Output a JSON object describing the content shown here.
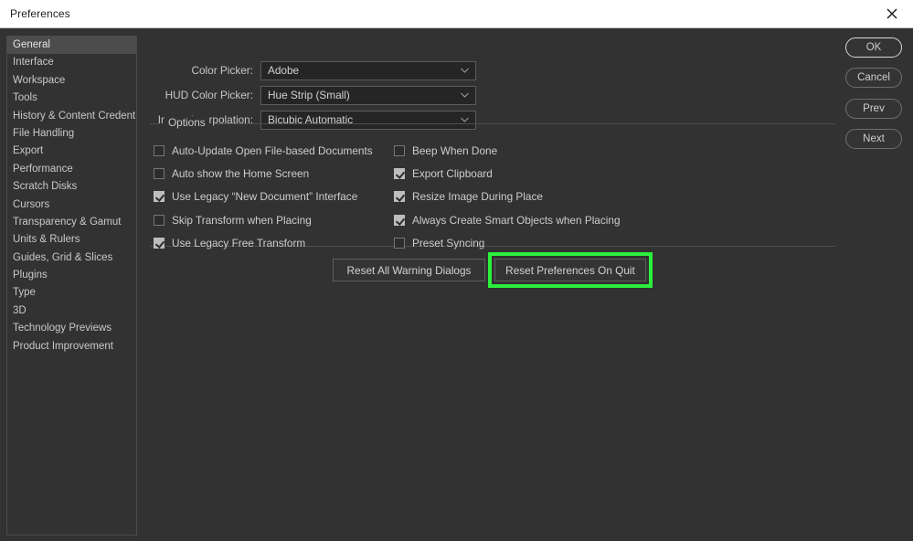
{
  "window": {
    "title": "Preferences",
    "close_icon": "close-icon"
  },
  "sidebar": {
    "items": [
      {
        "label": "General",
        "selected": true
      },
      {
        "label": "Interface",
        "selected": false
      },
      {
        "label": "Workspace",
        "selected": false
      },
      {
        "label": "Tools",
        "selected": false
      },
      {
        "label": "History & Content Credentials",
        "selected": false
      },
      {
        "label": "File Handling",
        "selected": false
      },
      {
        "label": "Export",
        "selected": false
      },
      {
        "label": "Performance",
        "selected": false
      },
      {
        "label": "Scratch Disks",
        "selected": false
      },
      {
        "label": "Cursors",
        "selected": false
      },
      {
        "label": "Transparency & Gamut",
        "selected": false
      },
      {
        "label": "Units & Rulers",
        "selected": false
      },
      {
        "label": "Guides, Grid & Slices",
        "selected": false
      },
      {
        "label": "Plugins",
        "selected": false
      },
      {
        "label": "Type",
        "selected": false
      },
      {
        "label": "3D",
        "selected": false
      },
      {
        "label": "Technology Previews",
        "selected": false
      },
      {
        "label": "Product Improvement",
        "selected": false
      }
    ]
  },
  "action_buttons": {
    "ok": "OK",
    "cancel": "Cancel",
    "prev": "Prev",
    "next": "Next"
  },
  "fields": [
    {
      "label": "Color Picker:",
      "value": "Adobe",
      "arrow_icon": "chevron-down-icon"
    },
    {
      "label": "HUD Color Picker:",
      "value": "Hue Strip (Small)",
      "arrow_icon": "chevron-down-icon"
    },
    {
      "label": "Image Interpolation:",
      "value": "Bicubic Automatic",
      "arrow_icon": "chevron-down-icon"
    }
  ],
  "options_group": {
    "legend": "Options",
    "left_column": [
      {
        "label": "Auto-Update Open File-based Documents",
        "checked": false
      },
      {
        "label": "Auto show the Home Screen",
        "checked": false
      },
      {
        "label": "Use Legacy “New Document” Interface",
        "checked": true
      },
      {
        "label": "Skip Transform when Placing",
        "checked": false
      },
      {
        "label": "Use Legacy Free Transform",
        "checked": true
      }
    ],
    "right_column": [
      {
        "label": "Beep When Done",
        "checked": false
      },
      {
        "label": "Export Clipboard",
        "checked": true
      },
      {
        "label": "Resize Image During Place",
        "checked": true
      },
      {
        "label": "Always Create Smart Objects when Placing",
        "checked": true
      },
      {
        "label": "Preset Syncing",
        "checked": false
      }
    ]
  },
  "bottom_buttons": {
    "reset_warnings": "Reset All Warning Dialogs",
    "reset_on_quit": "Reset Preferences On Quit"
  },
  "highlight": {
    "color": "#2bf03c",
    "target": "Reset Preferences On Quit"
  }
}
